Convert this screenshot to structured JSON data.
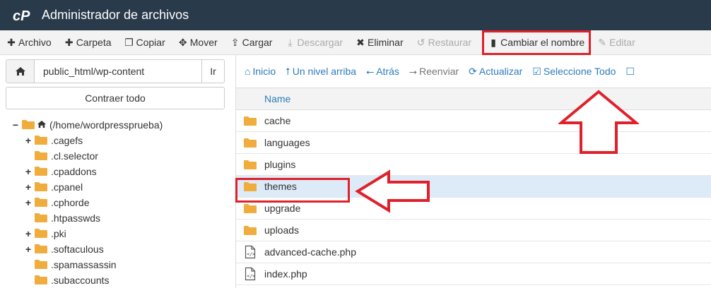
{
  "app": {
    "title": "Administrador de archivos"
  },
  "toolbar": {
    "archivo": "Archivo",
    "carpeta": "Carpeta",
    "copiar": "Copiar",
    "mover": "Mover",
    "cargar": "Cargar",
    "descargar": "Descargar",
    "eliminar": "Eliminar",
    "restaurar": "Restaurar",
    "cambiar": "Cambiar el nombre",
    "editar": "Editar"
  },
  "path": {
    "value": "public_html/wp-content",
    "go": "Ir"
  },
  "collapse_label": "Contraer todo",
  "tree": {
    "root": "(/home/wordpressprueba)",
    "items": [
      {
        "label": ".cagefs",
        "toggle": "+"
      },
      {
        "label": ".cl.selector",
        "toggle": ""
      },
      {
        "label": ".cpaddons",
        "toggle": "+"
      },
      {
        "label": ".cpanel",
        "toggle": "+"
      },
      {
        "label": ".cphorde",
        "toggle": "+"
      },
      {
        "label": ".htpasswds",
        "toggle": ""
      },
      {
        "label": ".pki",
        "toggle": "+"
      },
      {
        "label": ".softaculous",
        "toggle": "+"
      },
      {
        "label": ".spamassassin",
        "toggle": ""
      },
      {
        "label": ".subaccounts",
        "toggle": ""
      }
    ],
    "root_toggle": "−"
  },
  "nav": {
    "inicio": "Inicio",
    "nivel": "Un nivel arriba",
    "atras": "Atrás",
    "reenviar": "Reenviar",
    "actualizar": "Actualizar",
    "seleccione": "Seleccione Todo"
  },
  "table": {
    "header_name": "Name",
    "rows": [
      {
        "name": "cache",
        "type": "folder"
      },
      {
        "name": "languages",
        "type": "folder"
      },
      {
        "name": "plugins",
        "type": "folder"
      },
      {
        "name": "themes",
        "type": "folder",
        "selected": true
      },
      {
        "name": "upgrade",
        "type": "folder"
      },
      {
        "name": "uploads",
        "type": "folder"
      },
      {
        "name": "advanced-cache.php",
        "type": "php"
      },
      {
        "name": "index.php",
        "type": "php"
      }
    ]
  },
  "colors": {
    "header_bg": "#293a4a",
    "accent": "#2d7bbd",
    "highlight": "#e0202a",
    "folder": "#f0ad3e",
    "selected_row": "#dcebf7"
  }
}
